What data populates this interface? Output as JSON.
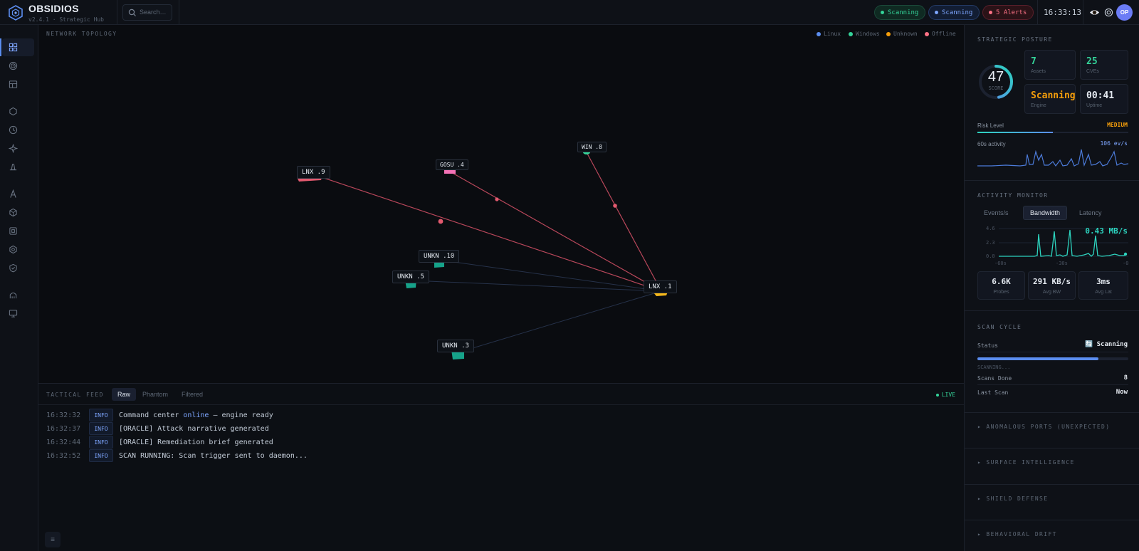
{
  "header": {
    "brand": "OBSIDIOS",
    "version": "v2.4.1 · Strategic Hub",
    "search_placeholder": "Search…",
    "status_scanning_1": "Scanning",
    "status_scanning_2": "Scanning",
    "alerts": "5 Alerts",
    "clock": "16:33:13",
    "avatar": "OP",
    "colors": {
      "green": "#34d399",
      "blue": "#7ea6ff",
      "red": "#fb7185",
      "accent": "#5b8def"
    }
  },
  "sidebar": {
    "items": [
      {
        "icon": "grid-icon",
        "active": true
      },
      {
        "icon": "target-icon"
      },
      {
        "icon": "layout-icon"
      },
      {
        "icon": "hexagon-icon"
      },
      {
        "icon": "clock-icon"
      },
      {
        "icon": "sparkle-icon"
      },
      {
        "icon": "cone-icon"
      },
      {
        "icon": "letter-a-icon"
      },
      {
        "icon": "cube-icon"
      },
      {
        "icon": "chip-icon"
      },
      {
        "icon": "hex-gear-icon"
      },
      {
        "icon": "shield-check-icon"
      },
      {
        "icon": "home-icon"
      },
      {
        "icon": "monitor-icon"
      }
    ]
  },
  "topology": {
    "title": "NETWORK TOPOLOGY",
    "legend": [
      {
        "label": "Linux",
        "color": "#5b8def"
      },
      {
        "label": "Windows",
        "color": "#34d399"
      },
      {
        "label": "Unknown",
        "color": "#f59e0b"
      },
      {
        "label": "Offline",
        "color": "#fb7185"
      }
    ],
    "nodes": [
      {
        "label": "LNX .9"
      },
      {
        "label": "GOSU .4"
      },
      {
        "label": "WIN .8"
      },
      {
        "label": "UNKN .10"
      },
      {
        "label": "UNKN .5"
      },
      {
        "label": "LNX .1"
      },
      {
        "label": "UNKN .3"
      }
    ]
  },
  "feed": {
    "title": "TACTICAL FEED",
    "tabs": [
      "Raw",
      "Phantom",
      "Filtered"
    ],
    "live": "LIVE",
    "logs": [
      {
        "time": "16:32:32",
        "level": "INFO",
        "pre": "Command center ",
        "hl": "online",
        "post": " — engine ready"
      },
      {
        "time": "16:32:37",
        "level": "INFO",
        "pre": "[ORACLE] Attack narrative generated",
        "hl": "",
        "post": ""
      },
      {
        "time": "16:32:44",
        "level": "INFO",
        "pre": "[ORACLE] Remediation brief generated",
        "hl": "",
        "post": ""
      },
      {
        "time": "16:32:52",
        "level": "INFO",
        "pre": "SCAN RUNNING: Scan trigger sent to daemon...",
        "hl": "",
        "post": ""
      }
    ],
    "toggle_icon": "≡"
  },
  "posture": {
    "title": "STRATEGIC POSTURE",
    "score": "47",
    "score_label": "SCORE",
    "score_fraction": 0.47,
    "cards": [
      {
        "value": "7",
        "label": "Assets",
        "color": "#34d399"
      },
      {
        "value": "25",
        "label": "CVEs",
        "color": "#34d399"
      },
      {
        "value": "Scanning",
        "label": "Engine",
        "color": "#f59e0b"
      },
      {
        "value": "00:41",
        "label": "Uptime",
        "color": "#e4e9f0"
      }
    ],
    "risk_label": "Risk Level",
    "risk_value": "MEDIUM",
    "risk_fraction": 0.5,
    "activity_label": "60s activity",
    "activity_value": "106 ev/s"
  },
  "activity": {
    "title": "ACTIVITY MONITOR",
    "tabs": [
      "Events/s",
      "Bandwidth",
      "Latency"
    ],
    "active_tab": "Bandwidth",
    "readout": "0.43 MB/s",
    "y_ticks": [
      "4.6",
      "2.3",
      "0.0"
    ],
    "x_ticks": [
      "-60s",
      "-30s",
      "-0"
    ],
    "stats": [
      {
        "value": "6.6K",
        "label": "Probes"
      },
      {
        "value": "291 KB/s",
        "label": "Avg BW"
      },
      {
        "value": "3ms",
        "label": "Avg Lat"
      }
    ]
  },
  "scan": {
    "title": "SCAN CYCLE",
    "status_label": "Status",
    "status_value": "🔄 Scanning",
    "progress_label": "SCANNING...",
    "progress_fraction": 0.8,
    "done_label": "Scans Done",
    "done_value": "8",
    "last_label": "Last Scan",
    "last_value": "Now"
  },
  "collapsibles": [
    "▸ ANOMALOUS PORTS (UNEXPECTED)",
    "▸ SURFACE INTELLIGENCE",
    "▸ SHIELD DEFENSE",
    "▸ BEHAVIORAL DRIFT"
  ]
}
